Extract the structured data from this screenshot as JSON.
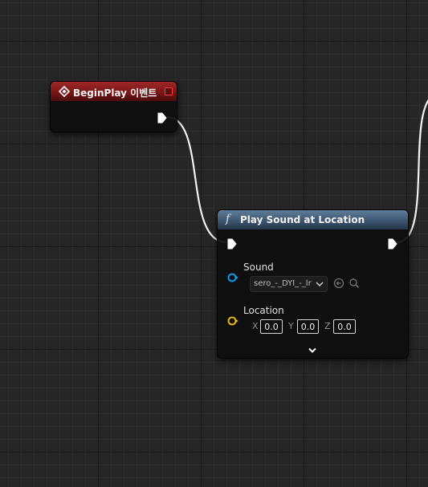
{
  "graph": {
    "nodes": {
      "begin_play": {
        "title": "BeginPlay 이벤트"
      },
      "play_sound": {
        "title": "Play Sound at Location",
        "sound": {
          "label": "Sound",
          "value": "sero_-_DYI_-_lr"
        },
        "location": {
          "label": "Location",
          "x_label": "X",
          "x_value": "0.0",
          "y_label": "Y",
          "y_value": "0.0",
          "z_label": "Z",
          "z_value": "0.0"
        }
      }
    }
  },
  "colors": {
    "event_header": "#7a1616",
    "function_header": "#3d5670",
    "object_pin": "#00a8f5",
    "vector_pin": "#f5c400",
    "delegate_pin": "#ff3636",
    "exec_pin": "#ffffff"
  },
  "icons": {
    "event": "event-diamond-icon",
    "function": "function-f-icon",
    "sound_browse": "arrow-left-circle-icon",
    "sound_search": "search-icon",
    "expand": "chevron-down-icon"
  }
}
